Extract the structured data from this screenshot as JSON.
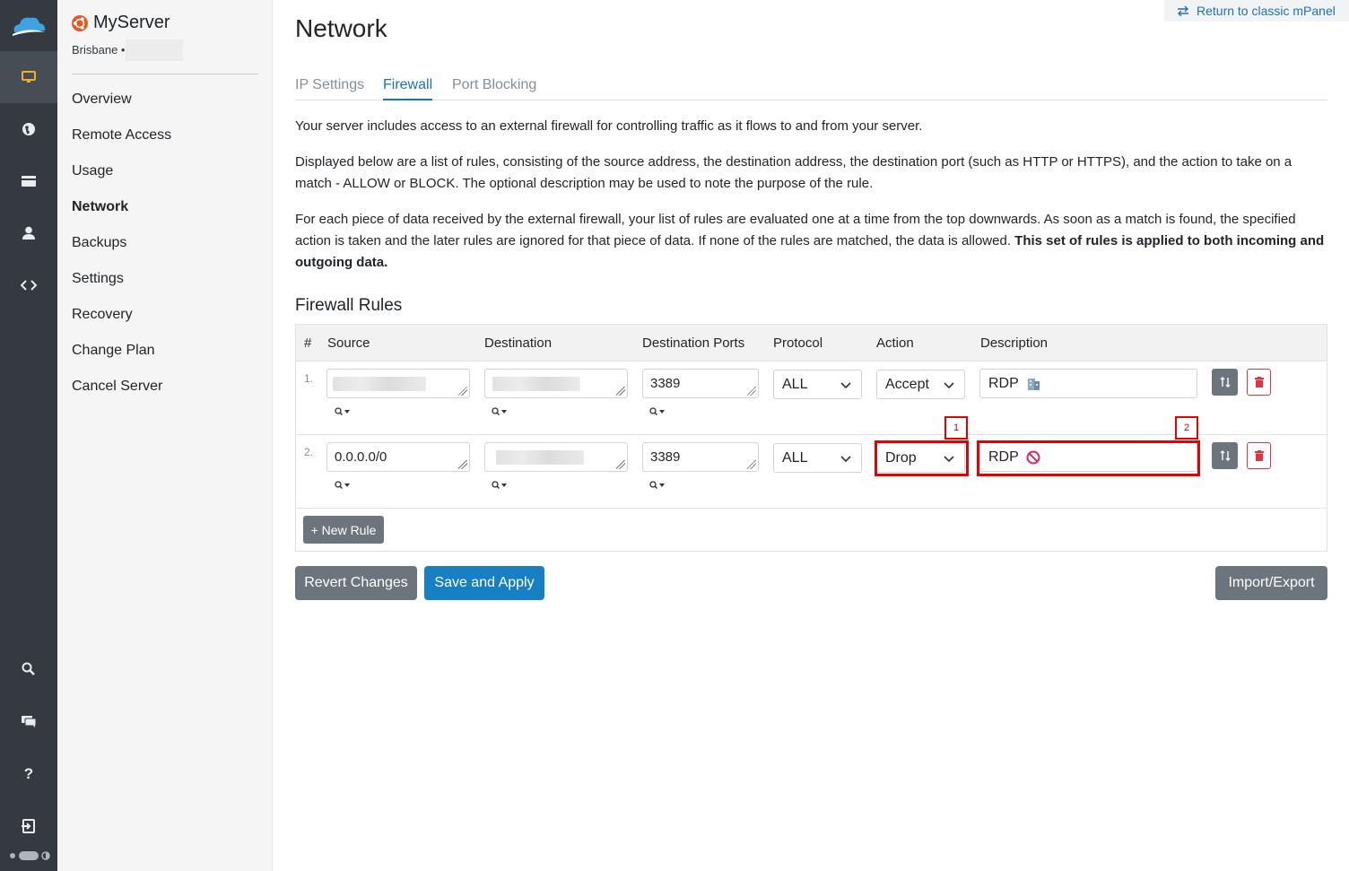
{
  "rail": {
    "items": [
      "monitor-icon",
      "globe-icon",
      "billing-card-icon",
      "account-icon",
      "code-icon"
    ],
    "bottom_items": [
      "search-icon",
      "chat-icon",
      "help-icon",
      "logout-icon"
    ]
  },
  "sidebar": {
    "server_name": "MyServer",
    "location": "Brisbane •",
    "items": [
      {
        "label": "Overview"
      },
      {
        "label": "Remote Access"
      },
      {
        "label": "Usage"
      },
      {
        "label": "Network"
      },
      {
        "label": "Backups"
      },
      {
        "label": "Settings"
      },
      {
        "label": "Recovery"
      },
      {
        "label": "Change Plan"
      },
      {
        "label": "Cancel Server"
      }
    ],
    "active": "Network"
  },
  "header": {
    "return_link": "Return to classic mPanel",
    "title": "Network"
  },
  "tabs": [
    {
      "label": "IP Settings"
    },
    {
      "label": "Firewall"
    },
    {
      "label": "Port Blocking"
    }
  ],
  "intro": {
    "p1": "Your server includes access to an external firewall for controlling traffic as it flows to and from your server.",
    "p2": "Displayed below are a list of rules, consisting of the source address, the destination address, the destination port (such as HTTP or HTTPS), and the action to take on a match - ALLOW or BLOCK. The optional description may be used to note the purpose of the rule.",
    "p3_text": "For each piece of data received by the external firewall, your list of rules are evaluated one at a time from the top downwards. As soon as a match is found, the specified action is taken and the later rules are ignored for that piece of data. If none of the rules are matched, the data is allowed. ",
    "p3_bold": "This set of rules is applied to both incoming and outgoing data."
  },
  "firewall": {
    "section_title": "Firewall Rules",
    "columns": [
      "#",
      "Source",
      "Destination",
      "Destination Ports",
      "Protocol",
      "Action",
      "Description"
    ],
    "rules": [
      {
        "num": "1.",
        "source": "",
        "destination": "",
        "ports": "3389",
        "protocol": "ALL",
        "action": "Accept",
        "description": "RDP",
        "desc_icon": "building-icon"
      },
      {
        "num": "2.",
        "source": "0.0.0.0/0",
        "destination": "",
        "ports": "3389",
        "protocol": "ALL",
        "action": "Drop",
        "description": "RDP",
        "desc_icon": "prohibited-icon"
      }
    ],
    "new_rule": "+ New Rule",
    "annotations": [
      "1",
      "2"
    ]
  },
  "actions": {
    "revert": "Revert Changes",
    "save": "Save and Apply",
    "import_export": "Import/Export"
  },
  "colors": {
    "accent": "#1780c4",
    "highlight": "#e60000",
    "rail_bg": "#343a40"
  }
}
